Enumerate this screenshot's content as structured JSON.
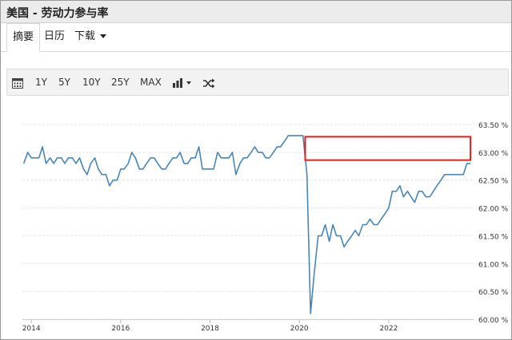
{
  "header": {
    "title": "美国 - 劳动力参与率"
  },
  "tabs": [
    {
      "label": "摘要",
      "active": true
    },
    {
      "label": "日历",
      "active": false
    },
    {
      "label": "下载",
      "active": false,
      "dropdown": true
    }
  ],
  "toolbar": {
    "calendar_icon": "calendar-icon",
    "ranges": [
      "1Y",
      "5Y",
      "10Y",
      "25Y",
      "MAX"
    ],
    "chart_type_icon": "bar-chart-icon",
    "compare_icon": "shuffle-icon"
  },
  "colors": {
    "line": "#4a86b5",
    "highlight_box": "#e0201a",
    "grid": "#e4e4e4"
  },
  "chart_data": {
    "type": "line",
    "title": "",
    "xlabel": "",
    "ylabel": "",
    "x_ticks": [
      "2014",
      "2016",
      "2018",
      "2020",
      "2022"
    ],
    "y_ticks": [
      "63.50 %",
      "63.00 %",
      "62.50 %",
      "62.00 %",
      "61.50 %",
      "61.00 %",
      "60.50 %",
      "60.00 %"
    ],
    "xlim": [
      2013.8,
      2023.9
    ],
    "ylim": [
      60.0,
      63.5
    ],
    "grid": true,
    "annotation": {
      "type": "rectangle",
      "x_range": [
        2020.13,
        2023.83
      ],
      "y_range": [
        62.86,
        63.28
      ]
    },
    "series": [
      {
        "x": [
          2013.83,
          2013.92,
          2014.0,
          2014.08,
          2014.17,
          2014.25,
          2014.33,
          2014.42,
          2014.5,
          2014.58,
          2014.67,
          2014.75,
          2014.83,
          2014.92,
          2015.0,
          2015.08,
          2015.17,
          2015.25,
          2015.33,
          2015.42,
          2015.5,
          2015.58,
          2015.67,
          2015.75,
          2015.83,
          2015.92,
          2016.0,
          2016.08,
          2016.17,
          2016.25,
          2016.33,
          2016.42,
          2016.5,
          2016.58,
          2016.67,
          2016.75,
          2016.83,
          2016.92,
          2017.0,
          2017.08,
          2017.17,
          2017.25,
          2017.33,
          2017.42,
          2017.5,
          2017.58,
          2017.67,
          2017.75,
          2017.83,
          2017.92,
          2018.0,
          2018.08,
          2018.17,
          2018.25,
          2018.33,
          2018.42,
          2018.5,
          2018.58,
          2018.67,
          2018.75,
          2018.83,
          2018.92,
          2019.0,
          2019.08,
          2019.17,
          2019.25,
          2019.33,
          2019.42,
          2019.5,
          2019.58,
          2019.67,
          2019.75,
          2019.83,
          2019.92,
          2020.0,
          2020.08,
          2020.17,
          2020.25,
          2020.33,
          2020.42,
          2020.5,
          2020.58,
          2020.67,
          2020.75,
          2020.83,
          2020.92,
          2021.0,
          2021.08,
          2021.17,
          2021.25,
          2021.33,
          2021.42,
          2021.5,
          2021.58,
          2021.67,
          2021.75,
          2021.83,
          2021.92,
          2022.0,
          2022.08,
          2022.17,
          2022.25,
          2022.33,
          2022.42,
          2022.5,
          2022.58,
          2022.67,
          2022.75,
          2022.83,
          2022.92,
          2023.0,
          2023.08,
          2023.17,
          2023.25,
          2023.33,
          2023.42,
          2023.5,
          2023.58,
          2023.67,
          2023.75,
          2023.83
        ],
        "values": [
          62.8,
          63.0,
          62.9,
          62.9,
          62.9,
          63.1,
          62.8,
          62.9,
          62.8,
          62.9,
          62.9,
          62.8,
          62.9,
          62.9,
          62.8,
          62.9,
          62.7,
          62.6,
          62.8,
          62.9,
          62.7,
          62.6,
          62.6,
          62.4,
          62.5,
          62.5,
          62.7,
          62.7,
          62.8,
          63.0,
          62.9,
          62.7,
          62.7,
          62.8,
          62.9,
          62.9,
          62.8,
          62.7,
          62.7,
          62.8,
          62.9,
          62.9,
          63.0,
          62.8,
          62.8,
          62.9,
          62.9,
          63.1,
          62.7,
          62.7,
          62.7,
          62.7,
          63.0,
          62.9,
          62.9,
          62.9,
          63.0,
          62.6,
          62.8,
          62.9,
          62.9,
          63.0,
          63.1,
          63.0,
          63.0,
          62.9,
          62.9,
          63.0,
          63.1,
          63.1,
          63.2,
          63.3,
          63.3,
          63.3,
          63.3,
          63.3,
          62.6,
          60.1,
          60.8,
          61.5,
          61.5,
          61.7,
          61.4,
          61.7,
          61.5,
          61.5,
          61.3,
          61.4,
          61.5,
          61.6,
          61.5,
          61.7,
          61.7,
          61.8,
          61.7,
          61.7,
          61.8,
          61.9,
          62.0,
          62.3,
          62.3,
          62.4,
          62.2,
          62.3,
          62.2,
          62.1,
          62.3,
          62.3,
          62.2,
          62.2,
          62.3,
          62.4,
          62.5,
          62.6,
          62.6,
          62.6,
          62.6,
          62.6,
          62.6,
          62.8,
          62.8
        ]
      }
    ]
  }
}
